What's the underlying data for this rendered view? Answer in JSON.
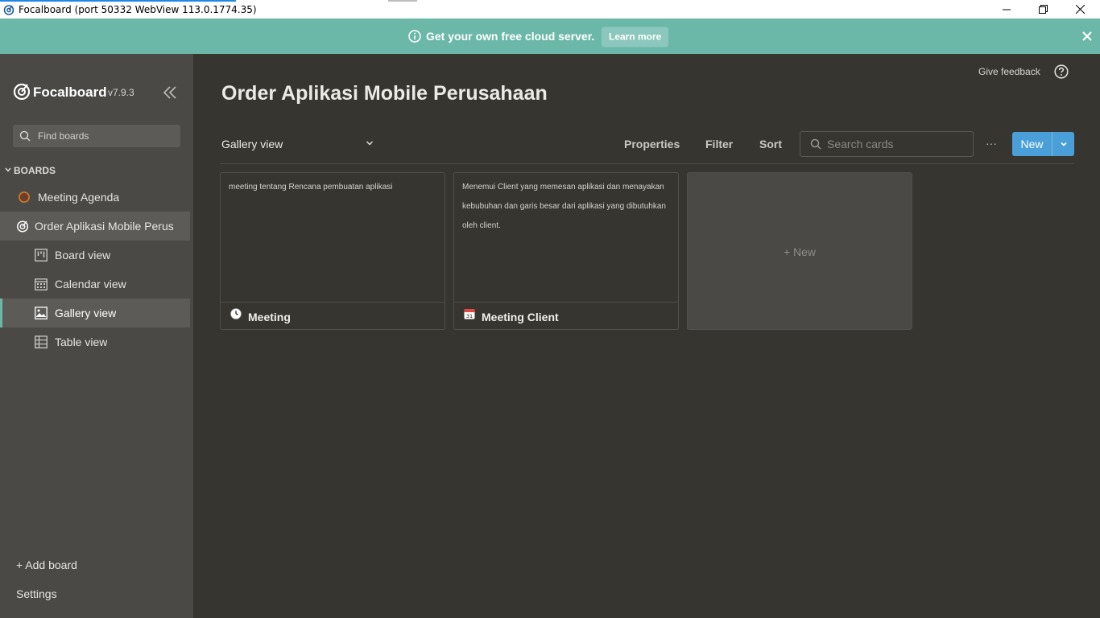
{
  "window": {
    "title": "Focalboard (port 50332 WebView 113.0.1774.35)",
    "icons": [
      "focalboard-logo-icon",
      "minimize-icon",
      "restore-icon",
      "close-icon"
    ]
  },
  "banner": {
    "message": "Get your own free cloud server.",
    "learn_more": "Learn more",
    "color": "#6bb8a9"
  },
  "sidebar": {
    "brand": "Focalboard",
    "version": "v7.9.3",
    "find_placeholder": "Find boards",
    "section": "BOARDS",
    "boards": [
      {
        "label": "Meeting Agenda",
        "icon": "donut-emoji-icon"
      },
      {
        "label": "Order Aplikasi Mobile Perus",
        "icon": "focalboard-board-icon"
      }
    ],
    "views": [
      {
        "label": "Board view",
        "icon": "board-view-icon"
      },
      {
        "label": "Calendar view",
        "icon": "calendar-view-icon"
      },
      {
        "label": "Gallery view",
        "icon": "gallery-view-icon"
      },
      {
        "label": "Table view",
        "icon": "table-view-icon"
      }
    ],
    "add_board": "+ Add board",
    "settings": "Settings"
  },
  "main": {
    "give_feedback": "Give feedback",
    "title": "Order Aplikasi Mobile Perusahaan",
    "view_selector": "Gallery view",
    "toolbar": {
      "properties": "Properties",
      "filter": "Filter",
      "sort": "Sort",
      "search_placeholder": "Search cards",
      "more": "···",
      "new": "New"
    },
    "cards": [
      {
        "content": "meeting tentang Rencana pembuatan aplikasi",
        "title": "Meeting",
        "icon": "clock-emoji-icon"
      },
      {
        "content": "Menemui Client yang memesan aplikasi dan menayakan kebubuhan dan garis besar dari aplikasi yang dibutuhkan oleh client.",
        "title": "Meeting Client",
        "icon": "calendar-emoji-icon"
      }
    ],
    "add_card": "+ New",
    "accent": "#4a9fd8"
  }
}
